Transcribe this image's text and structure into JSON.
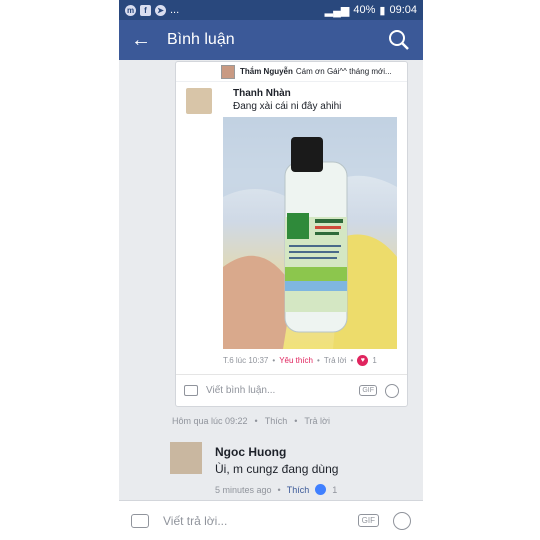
{
  "statusbar": {
    "battery": "40%",
    "time": "09:04",
    "dots": "..."
  },
  "appbar": {
    "title": "Bình luận"
  },
  "notification": {
    "author": "Thắm Nguyễn",
    "preview": "Cám ơn Gái^^ tháng mới..."
  },
  "reply": {
    "author": "Thanh Nhàn",
    "text": "Đang xài cái ni đây ahihi",
    "time": "T.6 lúc 10:37",
    "like": "Yêu thích",
    "reply": "Trả lời",
    "reaction_count": "1"
  },
  "reply_composer": {
    "placeholder": "Viết bình luận...",
    "gif": "GIF"
  },
  "parent_comment_meta": {
    "time": "Hôm qua lúc 09:22",
    "like": "Thích",
    "reply": "Trả lời"
  },
  "comment2": {
    "author": "Ngoc Huong",
    "text": "Ùi, m cungz đang dùng",
    "time": "5 minutes ago",
    "like": "Thích",
    "reaction_count": "1"
  },
  "bottom_composer": {
    "placeholder": "Viết trả lời...",
    "gif": "GIF"
  },
  "icons": [
    "messenger-icon",
    "facebook-icon",
    "telegram-icon",
    "back-arrow-icon",
    "search-icon",
    "camera-icon",
    "gif-icon",
    "emoji-icon",
    "heart-icon",
    "thumbs-up-icon"
  ],
  "colors": {
    "appbar": "#3b5998",
    "statusbar": "#29487d",
    "heart": "#e0245e",
    "thumb": "#4080ff"
  }
}
